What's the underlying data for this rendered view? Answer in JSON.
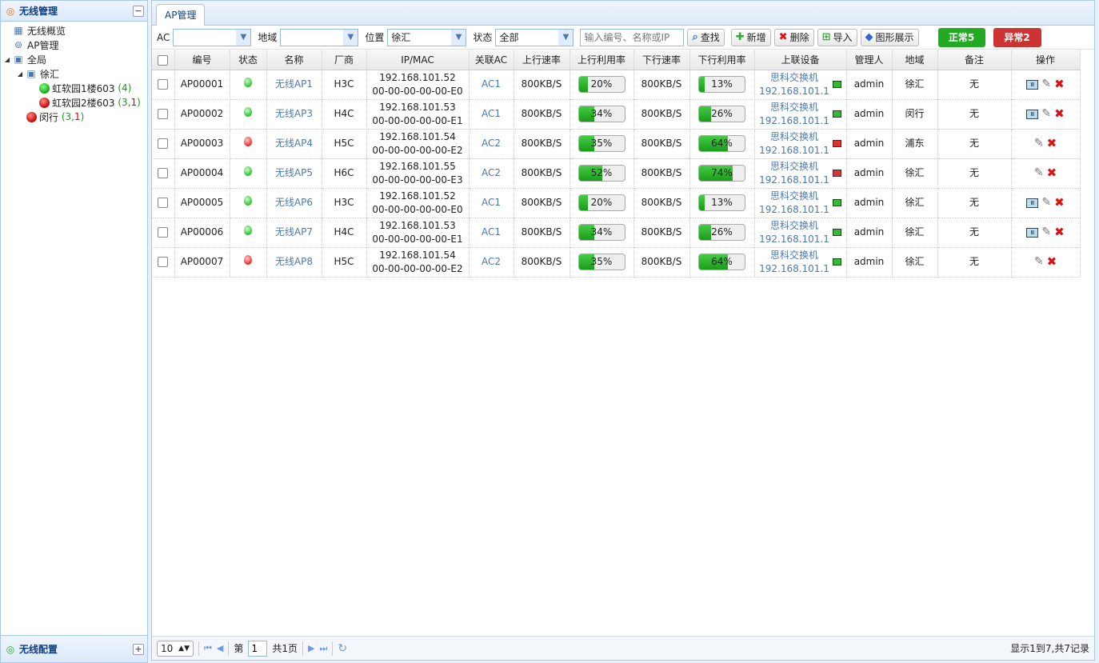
{
  "sidebar": {
    "title": "无线管理",
    "collapse": "−",
    "items": {
      "overview": "无线概览",
      "ap_manage": "AP管理",
      "all": "全局",
      "xuhui": "徐汇",
      "b1": "虹软园1楼603",
      "b1_cnt": "(4)",
      "b2": "虹软园2楼603",
      "b2_cnt_pre": "(3,",
      "b2_cnt_red": "1",
      "b2_cnt_post": ")",
      "minhang": "闵行",
      "mh_cnt_pre": "(3,",
      "mh_cnt_red": "1",
      "mh_cnt_post": ")"
    },
    "footer": "无线配置",
    "expand": "+"
  },
  "tab": "AP管理",
  "toolbar": {
    "ac_label": "AC",
    "ac_value": "",
    "region_label": "地域",
    "region_value": "",
    "position_label": "位置",
    "position_value": "徐汇",
    "state_label": "状态",
    "state_value": "全部",
    "search_placeholder": "输入编号、名称或IP",
    "search_btn": "查找",
    "add_btn": "新增",
    "delete_btn": "删除",
    "import_btn": "导入",
    "graph_btn": "图形展示",
    "normal": "正常5",
    "abnormal": "异常2"
  },
  "columns": [
    "编号",
    "状态",
    "名称",
    "厂商",
    "IP/MAC",
    "关联AC",
    "上行速率",
    "上行利用率",
    "下行速率",
    "下行利用率",
    "上联设备",
    "管理人",
    "地域",
    "备注",
    "操作"
  ],
  "rows": [
    {
      "id": "AP00001",
      "status": "on",
      "name": "无线AP1",
      "vendor": "H3C",
      "ip": "192.168.101.52",
      "mac": "00-00-00-00-00-E0",
      "ac": "AC1",
      "up": "800KB/S",
      "up_util": "20%",
      "up_p": 20,
      "down": "800KB/S",
      "down_util": "13%",
      "down_p": 13,
      "dev": "思科交换机",
      "dev_ip": "192.168.101.1",
      "dev_ok": true,
      "admin": "admin",
      "region": "徐汇",
      "remark": "无",
      "mon": true
    },
    {
      "id": "AP00002",
      "status": "on",
      "name": "无线AP3",
      "vendor": "H4C",
      "ip": "192.168.101.53",
      "mac": "00-00-00-00-00-E1",
      "ac": "AC1",
      "up": "800KB/S",
      "up_util": "34%",
      "up_p": 34,
      "down": "800KB/S",
      "down_util": "26%",
      "down_p": 26,
      "dev": "思科交换机",
      "dev_ip": "192.168.101.1",
      "dev_ok": true,
      "admin": "admin",
      "region": "闵行",
      "remark": "无",
      "mon": true
    },
    {
      "id": "AP00003",
      "status": "off",
      "name": "无线AP4",
      "vendor": "H5C",
      "ip": "192.168.101.54",
      "mac": "00-00-00-00-00-E2",
      "ac": "AC2",
      "up": "800KB/S",
      "up_util": "35%",
      "up_p": 35,
      "down": "800KB/S",
      "down_util": "64%",
      "down_p": 64,
      "dev": "思科交换机",
      "dev_ip": "192.168.101.1",
      "dev_ok": false,
      "admin": "admin",
      "region": "浦东",
      "remark": "无",
      "mon": false
    },
    {
      "id": "AP00004",
      "status": "on",
      "name": "无线AP5",
      "vendor": "H6C",
      "ip": "192.168.101.55",
      "mac": "00-00-00-00-00-E3",
      "ac": "AC2",
      "up": "800KB/S",
      "up_util": "52%",
      "up_p": 52,
      "down": "800KB/S",
      "down_util": "74%",
      "down_p": 74,
      "dev": "思科交换机",
      "dev_ip": "192.168.101.1",
      "dev_ok": false,
      "admin": "admin",
      "region": "徐汇",
      "remark": "无",
      "mon": false
    },
    {
      "id": "AP00005",
      "status": "on",
      "name": "无线AP6",
      "vendor": "H3C",
      "ip": "192.168.101.52",
      "mac": "00-00-00-00-00-E0",
      "ac": "AC1",
      "up": "800KB/S",
      "up_util": "20%",
      "up_p": 20,
      "down": "800KB/S",
      "down_util": "13%",
      "down_p": 13,
      "dev": "思科交换机",
      "dev_ip": "192.168.101.1",
      "dev_ok": true,
      "admin": "admin",
      "region": "徐汇",
      "remark": "无",
      "mon": true
    },
    {
      "id": "AP00006",
      "status": "on",
      "name": "无线AP7",
      "vendor": "H4C",
      "ip": "192.168.101.53",
      "mac": "00-00-00-00-00-E1",
      "ac": "AC1",
      "up": "800KB/S",
      "up_util": "34%",
      "up_p": 34,
      "down": "800KB/S",
      "down_util": "26%",
      "down_p": 26,
      "dev": "思科交换机",
      "dev_ip": "192.168.101.1",
      "dev_ok": true,
      "admin": "admin",
      "region": "徐汇",
      "remark": "无",
      "mon": true
    },
    {
      "id": "AP00007",
      "status": "off",
      "name": "无线AP8",
      "vendor": "H5C",
      "ip": "192.168.101.54",
      "mac": "00-00-00-00-00-E2",
      "ac": "AC2",
      "up": "800KB/S",
      "up_util": "35%",
      "up_p": 35,
      "down": "800KB/S",
      "down_util": "64%",
      "down_p": 64,
      "dev": "思科交换机",
      "dev_ip": "192.168.101.1",
      "dev_ok": true,
      "admin": "admin",
      "region": "徐汇",
      "remark": "无",
      "mon": false
    }
  ],
  "pager": {
    "page_size": "10",
    "page_prefix": "第",
    "page_value": "1",
    "page_total": "共1页",
    "info": "显示1到7,共7记录"
  },
  "colors": {
    "normal": "#22aa22",
    "abnormal": "#cc3333",
    "link": "#4a79b2"
  },
  "icons": {
    "monitor": "Ⅲ",
    "edit": "✎",
    "delete": "✖"
  }
}
